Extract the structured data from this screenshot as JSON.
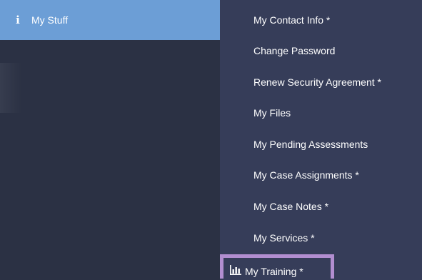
{
  "sidebar": {
    "active_item": {
      "icon": "info-icon",
      "label": "My Stuff"
    }
  },
  "submenu": {
    "items": [
      {
        "label": "My Contact Info *"
      },
      {
        "label": "Change Password"
      },
      {
        "label": "Renew Security Agreement *"
      },
      {
        "label": "My Files"
      },
      {
        "label": "My Pending Assessments"
      },
      {
        "label": "My Case Assignments *"
      },
      {
        "label": "My Case Notes *"
      },
      {
        "label": "My Services *"
      },
      {
        "label": "My Training *",
        "icon": "bar-chart-icon",
        "highlighted": true
      }
    ]
  },
  "colors": {
    "active_item_bg": "#6c9ed6",
    "sidebar_bg": "#2b3144",
    "submenu_bg": "#363d59",
    "highlight_border": "#b28ed0"
  }
}
